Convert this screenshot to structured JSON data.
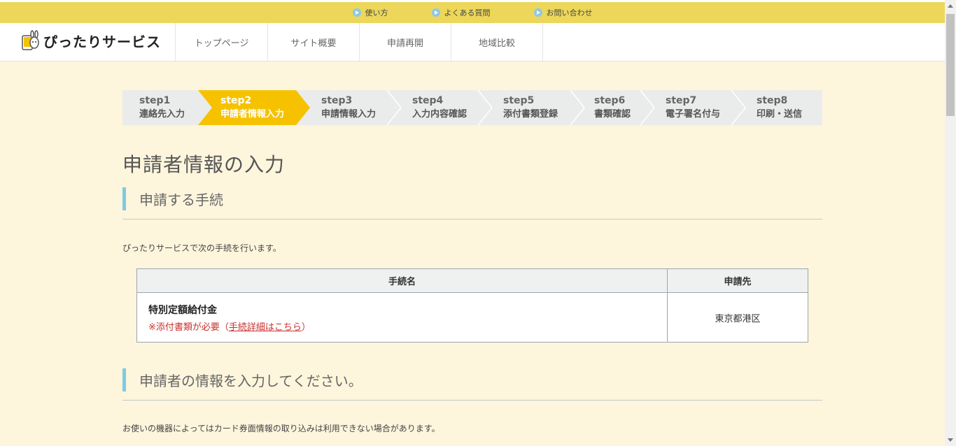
{
  "top_links": [
    {
      "label": "使い方",
      "icon": "play-circle-icon"
    },
    {
      "label": "よくある質問",
      "icon": "play-circle-icon"
    },
    {
      "label": "お問い合わせ",
      "icon": "play-circle-icon"
    }
  ],
  "header": {
    "logo_text": "ぴったりサービス",
    "nav": [
      "トップページ",
      "サイト概要",
      "申請再開",
      "地域比較"
    ]
  },
  "steps": [
    {
      "num": "step1",
      "label": "連絡先入力",
      "active": false
    },
    {
      "num": "step2",
      "label": "申請者情報入力",
      "active": true
    },
    {
      "num": "step3",
      "label": "申請情報入力",
      "active": false
    },
    {
      "num": "step4",
      "label": "入力内容確認",
      "active": false
    },
    {
      "num": "step5",
      "label": "添付書類登録",
      "active": false
    },
    {
      "num": "step6",
      "label": "書類確認",
      "active": false
    },
    {
      "num": "step7",
      "label": "電子署名付与",
      "active": false
    },
    {
      "num": "step8",
      "label": "印刷・送信",
      "active": false
    }
  ],
  "page_title": "申請者情報の入力",
  "section1": {
    "heading": "申請する手続",
    "description": "ぴったりサービスで次の手続を行います。"
  },
  "table": {
    "headers": [
      "手続名",
      "申請先"
    ],
    "row": {
      "name": "特別定額給付金",
      "note_prefix": "※添付書類が必要（",
      "note_link": "手続詳細はこちら",
      "note_suffix": "）",
      "destination": "東京都港区"
    }
  },
  "section2": {
    "heading": "申請者の情報を入力してください。",
    "description": "お使いの機器によってはカード券面情報の取り込みは利用できない場合があります。"
  },
  "colors": {
    "topbar": "#ecd75a",
    "active_step": "#f6c200",
    "accent_bar": "#7dcbe5",
    "note_red": "#c9302c"
  }
}
